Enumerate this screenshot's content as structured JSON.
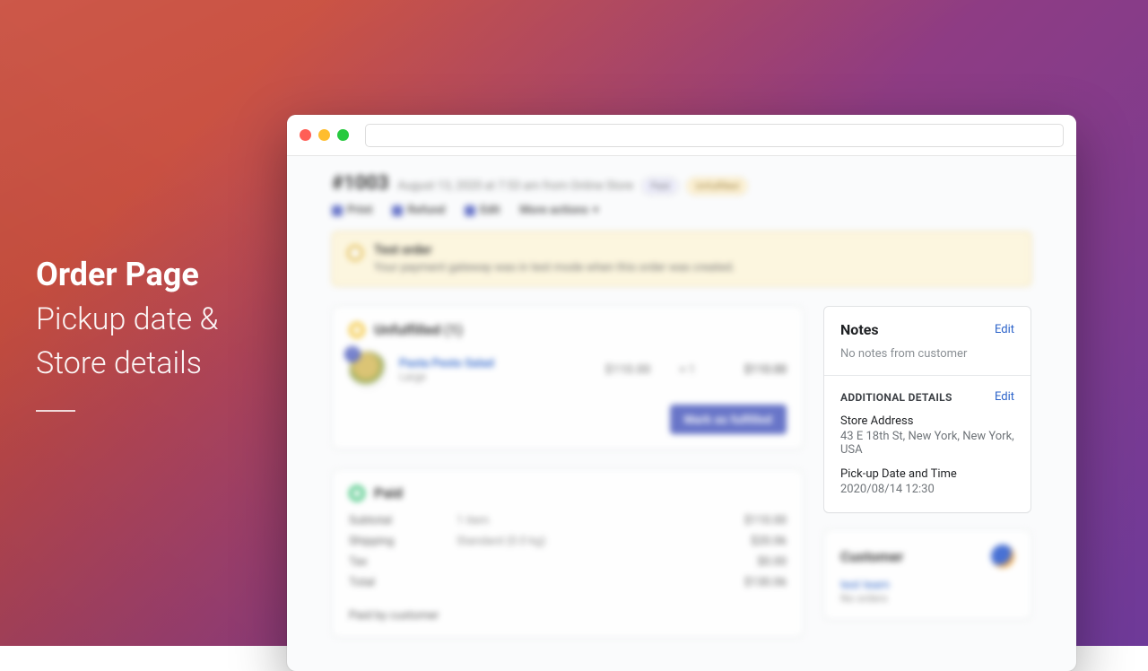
{
  "caption": {
    "line1": "Order Page",
    "line2": "Pickup date &",
    "line3": "Store details"
  },
  "order": {
    "number": "#1003",
    "meta": "August 13, 2020 at 7:53 am from Online Store",
    "badge_paid": "Paid",
    "badge_unfulfilled": "Unfulfilled"
  },
  "toolbar": {
    "print": "Print",
    "refund": "Refund",
    "edit": "Edit",
    "more": "More actions"
  },
  "notice": {
    "title": "Test order",
    "body": "Your payment gateway was in test mode when this order was created."
  },
  "fulfillment": {
    "heading": "Unfulfilled (1)",
    "item": {
      "name": "Pasta Pesto Salad",
      "variant": "Large",
      "price": "$110.00",
      "qty_sep": "× 1",
      "total": "$110.00",
      "badge_qty": "1"
    },
    "button": "Mark as fulfilled"
  },
  "payment": {
    "heading": "Paid",
    "rows": [
      {
        "k": "Subtotal",
        "v2": "1 item",
        "a": "$110.00"
      },
      {
        "k": "Shipping",
        "v2": "Standard (0.0 kg)",
        "a": "$20.06"
      },
      {
        "k": "Tax",
        "v2": "",
        "a": "$0.00"
      },
      {
        "k": "Total",
        "v2": "",
        "a": "$130.06"
      }
    ],
    "paid_by": "Paid by customer"
  },
  "notes": {
    "title": "Notes",
    "edit": "Edit",
    "empty": "No notes from customer",
    "additional_title": "ADDITIONAL DETAILS",
    "store_label": "Store Address",
    "store_value": "43 E 18th St, New York, New York, USA",
    "pickup_label": "Pick-up Date and Time",
    "pickup_value": "2020/08/14 12:30"
  },
  "customer": {
    "title": "Customer",
    "name": "test team",
    "sub": "No orders"
  }
}
